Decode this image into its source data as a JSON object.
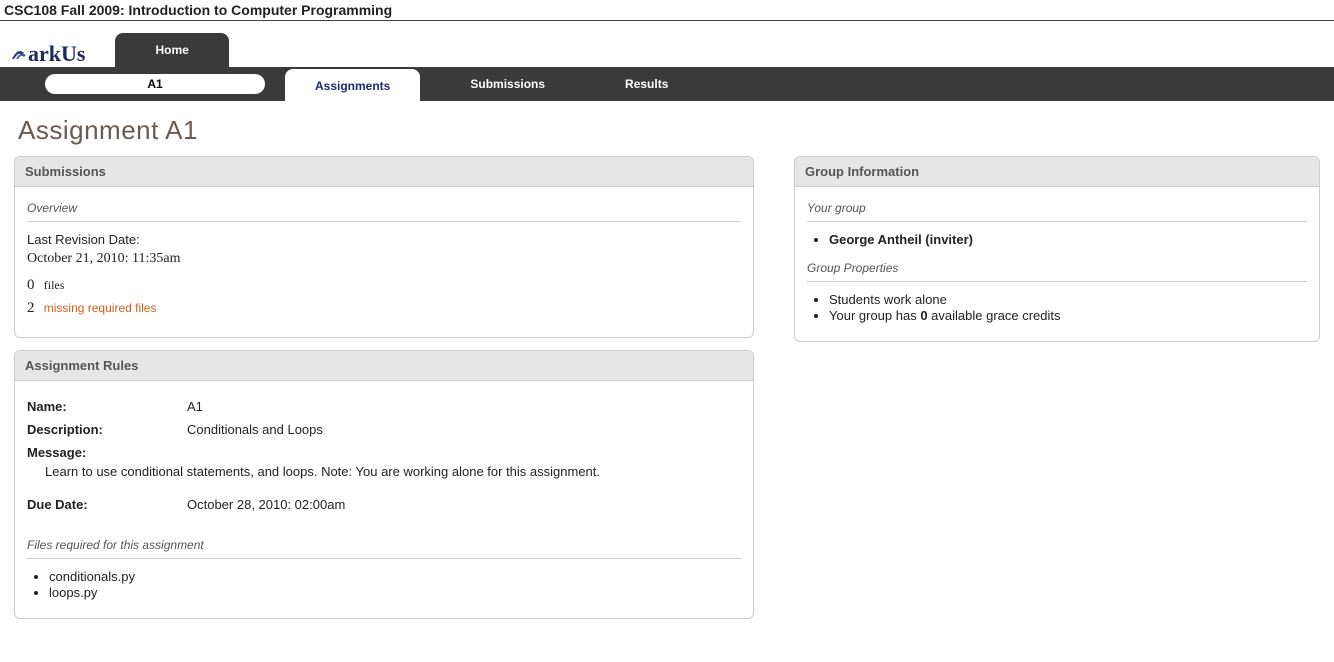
{
  "course_title": "CSC108 Fall 2009: Introduction to Computer Programming",
  "logo_text": "arkUs",
  "home_tab": "Home",
  "pill_label": "A1",
  "nav": {
    "assignments": "Assignments",
    "submissions": "Submissions",
    "results": "Results"
  },
  "page_heading": "Assignment A1",
  "submissions_panel": {
    "title": "Submissions",
    "overview_label": "Overview",
    "last_rev_label": "Last Revision Date:",
    "last_rev_value": "October 21, 2010: 11:35am",
    "files_count": "0",
    "files_word": "files",
    "missing_count": "2",
    "missing_text": "missing required files"
  },
  "rules_panel": {
    "title": "Assignment Rules",
    "name_label": "Name:",
    "name_value": "A1",
    "desc_label": "Description:",
    "desc_value": "Conditionals and Loops",
    "msg_label": "Message:",
    "msg_value": "Learn to use conditional statements, and loops. Note: You are working alone for this assignment.",
    "due_label": "Due Date:",
    "due_value": "October 28, 2010: 02:00am",
    "files_req_label": "Files required for this assignment",
    "file1": "conditionals.py",
    "file2": "loops.py"
  },
  "group_panel": {
    "title": "Group Information",
    "your_group_label": "Your group",
    "member": "George Antheil (inviter)",
    "props_label": "Group Properties",
    "prop1": "Students work alone",
    "prop2_pre": "Your group has ",
    "prop2_count": "0",
    "prop2_post": " available grace credits"
  }
}
